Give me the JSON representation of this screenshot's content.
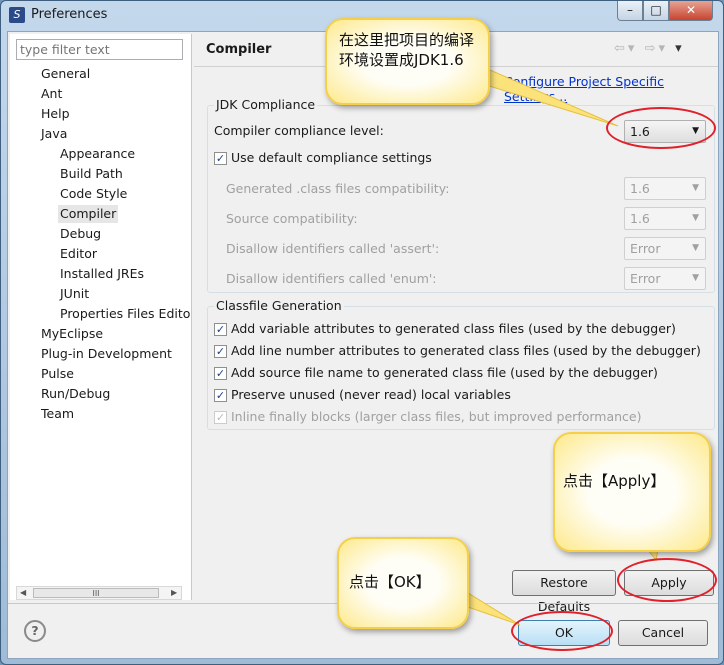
{
  "window": {
    "title": "Preferences",
    "controls": [
      "minimize",
      "maximize",
      "close"
    ]
  },
  "sidebar": {
    "filter_placeholder": "type filter text",
    "items": [
      {
        "label": "General",
        "level": 0
      },
      {
        "label": "Ant",
        "level": 0
      },
      {
        "label": "Help",
        "level": 0
      },
      {
        "label": "Java",
        "level": 0
      },
      {
        "label": "Appearance",
        "level": 1
      },
      {
        "label": "Build Path",
        "level": 1
      },
      {
        "label": "Code Style",
        "level": 1
      },
      {
        "label": "Compiler",
        "level": 1,
        "selected": true
      },
      {
        "label": "Debug",
        "level": 1
      },
      {
        "label": "Editor",
        "level": 1
      },
      {
        "label": "Installed JREs",
        "level": 1
      },
      {
        "label": "JUnit",
        "level": 1
      },
      {
        "label": "Properties Files Edito",
        "level": 1
      },
      {
        "label": "MyEclipse",
        "level": 0
      },
      {
        "label": "Plug-in Development",
        "level": 0
      },
      {
        "label": "Pulse",
        "level": 0
      },
      {
        "label": "Run/Debug",
        "level": 0
      },
      {
        "label": "Team",
        "level": 0
      }
    ],
    "scroll_grip": "III"
  },
  "main": {
    "title": "Compiler",
    "configure_link": "Configure Project Specific Settings...",
    "jdk": {
      "group_label": "JDK Compliance",
      "compliance_label": "Compiler compliance level:",
      "compliance_value": "1.6",
      "use_default_label": "Use default compliance settings",
      "use_default_checked": true,
      "rows": [
        {
          "label": "Generated .class files compatibility:",
          "value": "1.6"
        },
        {
          "label": "Source compatibility:",
          "value": "1.6"
        },
        {
          "label": "Disallow identifiers called 'assert':",
          "value": "Error"
        },
        {
          "label": "Disallow identifiers called 'enum':",
          "value": "Error"
        }
      ]
    },
    "classfile": {
      "group_label": "Classfile Generation",
      "options": [
        {
          "label": "Add variable attributes to generated class files (used by the debugger)",
          "checked": true
        },
        {
          "label": "Add line number attributes to generated class files (used by the debugger)",
          "checked": true
        },
        {
          "label": "Add source file name to generated class file (used by the debugger)",
          "checked": true
        },
        {
          "label": "Preserve unused (never read) local variables",
          "checked": true
        },
        {
          "label": "Inline finally blocks (larger class files, but improved performance)",
          "checked": true,
          "disabled": true
        }
      ]
    },
    "restore_defaults": "Restore Defaults",
    "apply": "Apply"
  },
  "footer": {
    "ok": "OK",
    "cancel": "Cancel",
    "help_icon": "?"
  },
  "annotations": {
    "callout_compiler": "在这里把项目的编译环境设置成JDK1.6",
    "callout_apply": "点击【Apply】",
    "callout_ok": "点击【OK】",
    "highlight_color": "#e0202a",
    "callout_color": "#fde98a"
  }
}
